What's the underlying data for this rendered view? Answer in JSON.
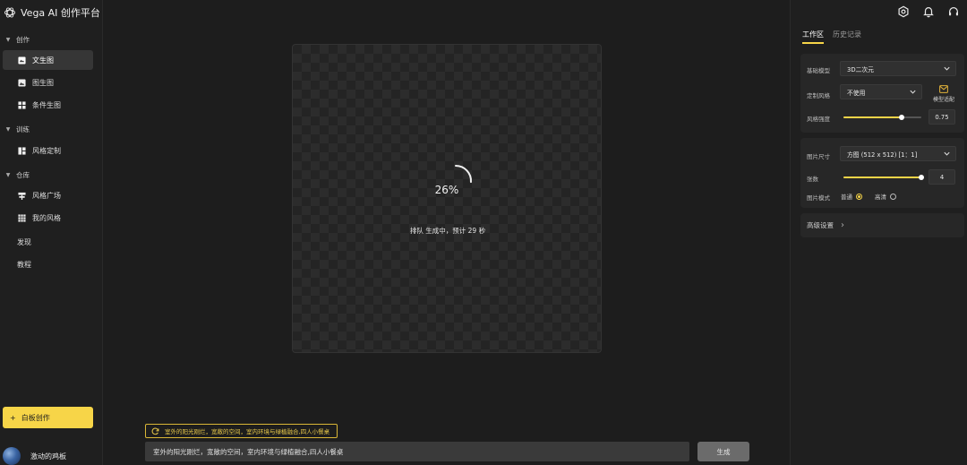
{
  "app": {
    "title": "Vega AI 创作平台"
  },
  "sidebar": {
    "groups": [
      {
        "label": "创作",
        "items": [
          "文生图",
          "图生图",
          "条件生图"
        ]
      },
      {
        "label": "训练",
        "items": [
          "风格定制"
        ]
      },
      {
        "label": "仓库",
        "items": [
          "风格广场",
          "我的风格"
        ]
      }
    ],
    "links": [
      "发现",
      "教程"
    ],
    "active_item": "文生图",
    "whiteboard_button": "白板创作",
    "whiteboard_plus": "+",
    "user_name": "激动的鸡板"
  },
  "main": {
    "progress_percent": 26,
    "progress_text": "26%",
    "queue_status": "排队 生成中，预计 29 秒",
    "suggestion": "室外的阳光刚烂，宽敞的空间，室内环境与绿植融合,四人小餐桌",
    "prompt_value": "室外的阳光刚烂，宽敞的空间，室内环境与绿植融合,四人小餐桌",
    "generate_button": "生成"
  },
  "right_panel": {
    "tabs": [
      "工作区",
      "历史记录"
    ],
    "active_tab": "工作区",
    "base_model_label": "基础模型",
    "base_model_value": "3D二次元",
    "custom_style_label": "定制风格",
    "custom_style_value": "不使用",
    "model_adapt_label": "模型适配",
    "style_strength_label": "风格强度",
    "style_strength_value": "0.75",
    "image_size_label": "图片尺寸",
    "image_size_value": "方图  (512 x 512)  [1：1]",
    "count_label": "张数",
    "count_value": "4",
    "image_mode_label": "图片模式",
    "mode_options": [
      "普通",
      "高清"
    ],
    "mode_selected": "普通",
    "advanced_label": "高级设置",
    "advanced_chevron": "›"
  },
  "colors": {
    "accent": "#f7d548",
    "background": "#1d1d1d",
    "panel": "#272727"
  },
  "icons": [
    "logo-icon",
    "settings-icon",
    "bell-icon",
    "headset-icon",
    "refresh-icon"
  ]
}
